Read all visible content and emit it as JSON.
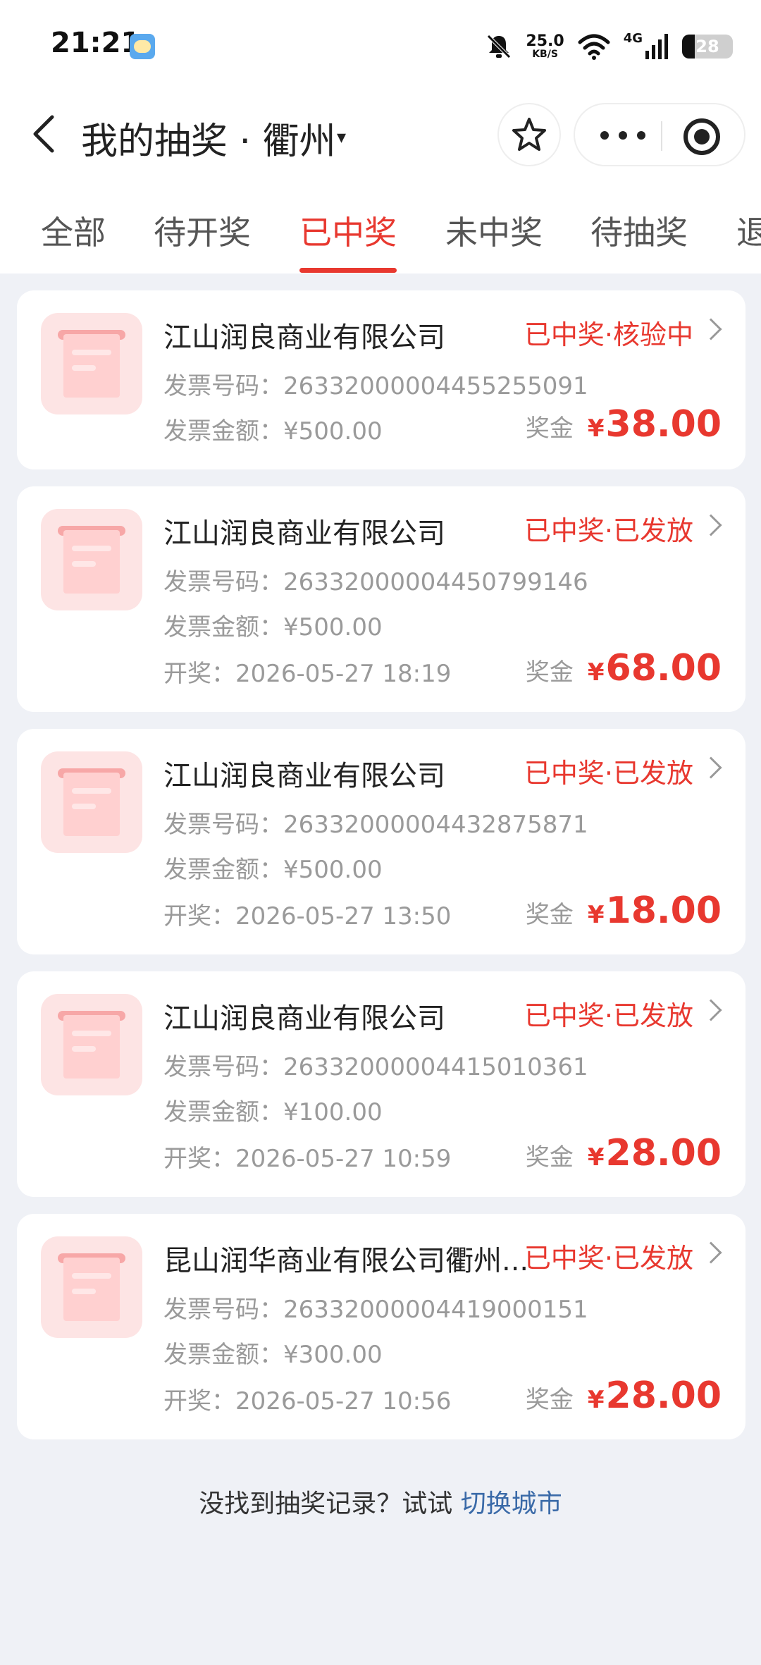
{
  "status_bar": {
    "time": "21:21",
    "net_speed": "25.0",
    "net_unit": "KB/S",
    "signal": "4G",
    "battery": "28"
  },
  "nav": {
    "title": "我的抽奖 · 衢州",
    "caret": "▾"
  },
  "tabs": [
    {
      "label": "全部"
    },
    {
      "label": "待开奖"
    },
    {
      "label": "已中奖"
    },
    {
      "label": "未中奖"
    },
    {
      "label": "待抽奖"
    },
    {
      "label": "退"
    }
  ],
  "active_tab": 2,
  "prize_label": "奖金",
  "yen": "¥",
  "cards": [
    {
      "company": "江山润良商业有限公司",
      "status": "已中奖·核验中",
      "invoice_no": "发票号码：26332000004455255091",
      "amount": "发票金额：¥500.00",
      "draw_time": "",
      "prize": "38.00"
    },
    {
      "company": "江山润良商业有限公司",
      "status": "已中奖·已发放",
      "invoice_no": "发票号码：26332000004450799146",
      "amount": "发票金额：¥500.00",
      "draw_time": "开奖：2026-05-27 18:19",
      "prize": "68.00"
    },
    {
      "company": "江山润良商业有限公司",
      "status": "已中奖·已发放",
      "invoice_no": "发票号码：26332000004432875871",
      "amount": "发票金额：¥500.00",
      "draw_time": "开奖：2026-05-27 13:50",
      "prize": "18.00"
    },
    {
      "company": "江山润良商业有限公司",
      "status": "已中奖·已发放",
      "invoice_no": "发票号码：26332000004415010361",
      "amount": "发票金额：¥100.00",
      "draw_time": "开奖：2026-05-27 10:59",
      "prize": "28.00"
    },
    {
      "company": "昆山润华商业有限公司衢州...",
      "status": "已中奖·已发放",
      "invoice_no": "发票号码：26332000004419000151",
      "amount": "发票金额：¥300.00",
      "draw_time": "开奖：2026-05-27 10:56",
      "prize": "28.00"
    }
  ],
  "footer": {
    "text": "没找到抽奖记录？试试 ",
    "link": "切换城市"
  },
  "colors": {
    "accent": "#e8382f",
    "link": "#3a6aa8",
    "background": "#eff1f6"
  }
}
